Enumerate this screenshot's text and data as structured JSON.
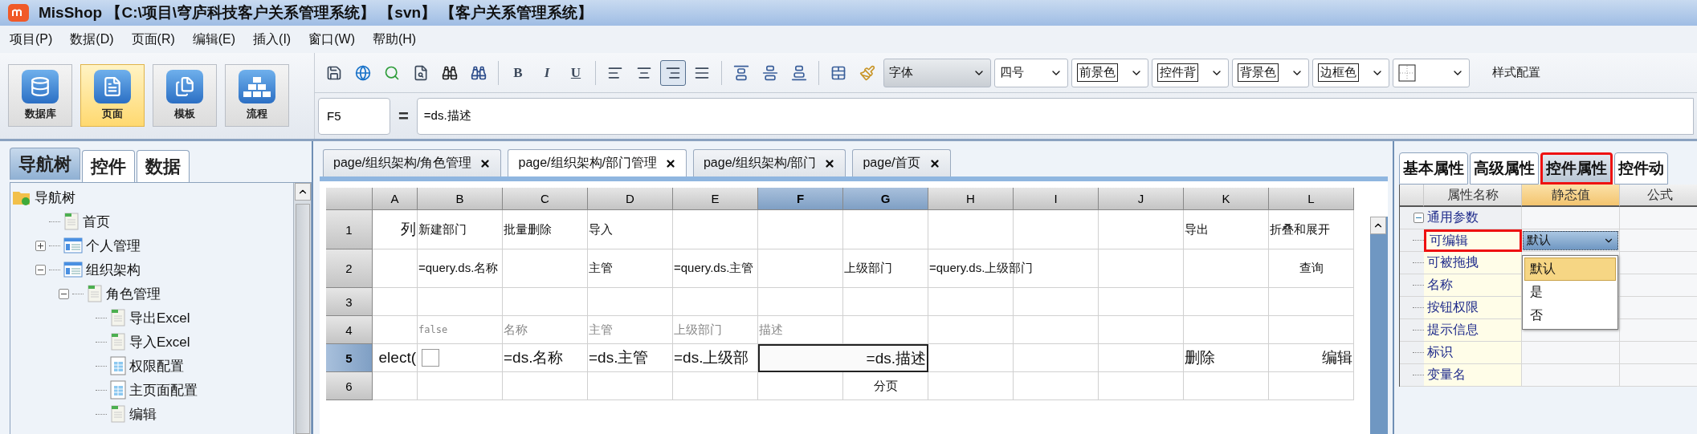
{
  "window": {
    "title": "MisShop 【C:\\项目\\穹庐科技客户关系管理系统】 【svn】 【客户关系管理系统】"
  },
  "menu": [
    "项目(P)",
    "数据(D)",
    "页面(R)",
    "编辑(E)",
    "插入(I)",
    "窗口(W)",
    "帮助(H)"
  ],
  "big_buttons": [
    {
      "label": "数据库",
      "selected": false
    },
    {
      "label": "页面",
      "selected": true
    },
    {
      "label": "模板",
      "selected": false
    },
    {
      "label": "流程",
      "selected": false
    }
  ],
  "text_buttons": [
    "B",
    "I",
    "U"
  ],
  "align_buttons": [
    {
      "selected": false
    },
    {
      "selected": false
    },
    {
      "selected": true
    },
    {
      "selected": false
    }
  ],
  "dropdowns": [
    {
      "value": "字体",
      "kind": "font"
    },
    {
      "value": "四号",
      "kind": "plain"
    },
    {
      "value": "前景色",
      "kind": "boxed"
    },
    {
      "value": "控件背",
      "kind": "boxed"
    },
    {
      "value": "背景色",
      "kind": "boxed"
    },
    {
      "value": "边框色",
      "kind": "boxed"
    },
    {
      "kind": "border"
    }
  ],
  "style_config": "样式配置",
  "formula_bar": {
    "cell": "F5",
    "equals": "=",
    "formula": "=ds.描述"
  },
  "left_tabs": [
    {
      "label": "导航树",
      "selected": true
    },
    {
      "label": "控件",
      "selected": false
    },
    {
      "label": "数据",
      "selected": false
    }
  ],
  "tree": [
    {
      "label": "导航树",
      "kind": "folder",
      "children": [
        {
          "label": "首页",
          "kind": "page"
        },
        {
          "label": "个人管理",
          "kind": "module",
          "expanded": false
        },
        {
          "label": "组织架构",
          "kind": "module",
          "expanded": true,
          "children": [
            {
              "label": "角色管理",
              "kind": "page",
              "expanded": true,
              "children": [
                {
                  "label": "导出Excel",
                  "kind": "page"
                },
                {
                  "label": "导入Excel",
                  "kind": "page"
                },
                {
                  "label": "权限配置",
                  "kind": "sheet"
                },
                {
                  "label": "主页面配置",
                  "kind": "sheet"
                },
                {
                  "label": "编辑",
                  "kind": "page"
                }
              ]
            }
          ]
        }
      ]
    }
  ],
  "doc_tabs": [
    {
      "label": "page/组织架构/角色管理",
      "selected": false
    },
    {
      "label": "page/组织架构/部门管理",
      "selected": true
    },
    {
      "label": "page/组织架构/部门",
      "selected": false
    },
    {
      "label": "page/首页",
      "selected": false
    }
  ],
  "sheet": {
    "columns": [
      {
        "label": "A",
        "selected": false
      },
      {
        "label": "B",
        "selected": false
      },
      {
        "label": "C",
        "selected": false
      },
      {
        "label": "D",
        "selected": false
      },
      {
        "label": "E",
        "selected": false
      },
      {
        "label": "F",
        "selected": true
      },
      {
        "label": "G",
        "selected": true
      },
      {
        "label": "H",
        "selected": false
      },
      {
        "label": "I",
        "selected": false
      },
      {
        "label": "J",
        "selected": false
      },
      {
        "label": "K",
        "selected": false
      },
      {
        "label": "L",
        "selected": false
      }
    ],
    "rows": [
      {
        "label": "1",
        "selected": false,
        "kind": "buttons",
        "cells": [
          "列",
          "新建部门",
          "批量删除",
          "导入",
          "",
          "",
          "",
          "",
          "",
          "",
          "导出",
          "折叠和展开"
        ]
      },
      {
        "label": "2",
        "selected": false,
        "cells": [
          "",
          "=query.ds.名称",
          "",
          "主管",
          "=query.ds.主管",
          "",
          "上级部门",
          "=query.ds.上级部门",
          "",
          "",
          "",
          "查询"
        ]
      },
      {
        "label": "3",
        "selected": false,
        "cells": [
          "",
          "",
          "",
          "",
          "",
          "",
          "",
          "",
          "",
          "",
          "",
          ""
        ]
      },
      {
        "label": "4",
        "selected": false,
        "kind": "labels",
        "cells": [
          "",
          "false",
          "名称",
          "主管",
          "上级部门",
          "描述",
          "",
          "",
          "",
          "",
          "",
          ""
        ]
      },
      {
        "label": "5",
        "selected": true,
        "kind": "data",
        "cells": [
          "elect(",
          {
            "kind": "checkbox",
            "checked": false
          },
          "=ds.名称",
          "=ds.主管",
          "=ds.上级部",
          "",
          "=ds.描述",
          "",
          "",
          "",
          "删除",
          "编辑"
        ]
      },
      {
        "label": "6",
        "selected": false,
        "cells": [
          "",
          "",
          "",
          "",
          "",
          "",
          "分页",
          "",
          "",
          "",
          "",
          ""
        ]
      }
    ]
  },
  "right_tabs": [
    {
      "label": "基本属性",
      "selected": false,
      "highlighted": false
    },
    {
      "label": "高级属性",
      "selected": false,
      "highlighted": false
    },
    {
      "label": "控件属性",
      "selected": true,
      "highlighted": true
    },
    {
      "label": "控件动",
      "selected": false,
      "highlighted": false
    }
  ],
  "prop_columns": [
    {
      "label": "属性名称",
      "selected": false
    },
    {
      "label": "静态值",
      "selected": true
    },
    {
      "label": "公式",
      "selected": false
    }
  ],
  "props": [
    {
      "name": "通用参数",
      "kind": "group",
      "expanded": true,
      "highlighted": false
    },
    {
      "name": "可编辑",
      "kind": "prop",
      "highlighted": true,
      "value": "默认",
      "open": true,
      "options": [
        {
          "label": "默认",
          "selected": true
        },
        {
          "label": "是",
          "selected": false
        },
        {
          "label": "否",
          "selected": false
        }
      ]
    },
    {
      "name": "可被拖拽",
      "kind": "prop",
      "highlighted": false
    },
    {
      "name": "名称",
      "kind": "prop",
      "highlighted": false
    },
    {
      "name": "按钮权限",
      "kind": "prop",
      "highlighted": false
    },
    {
      "name": "提示信息",
      "kind": "prop",
      "highlighted": false
    },
    {
      "name": "标识",
      "kind": "prop",
      "highlighted": false
    },
    {
      "name": "变量名",
      "kind": "prop",
      "highlighted": false
    }
  ]
}
